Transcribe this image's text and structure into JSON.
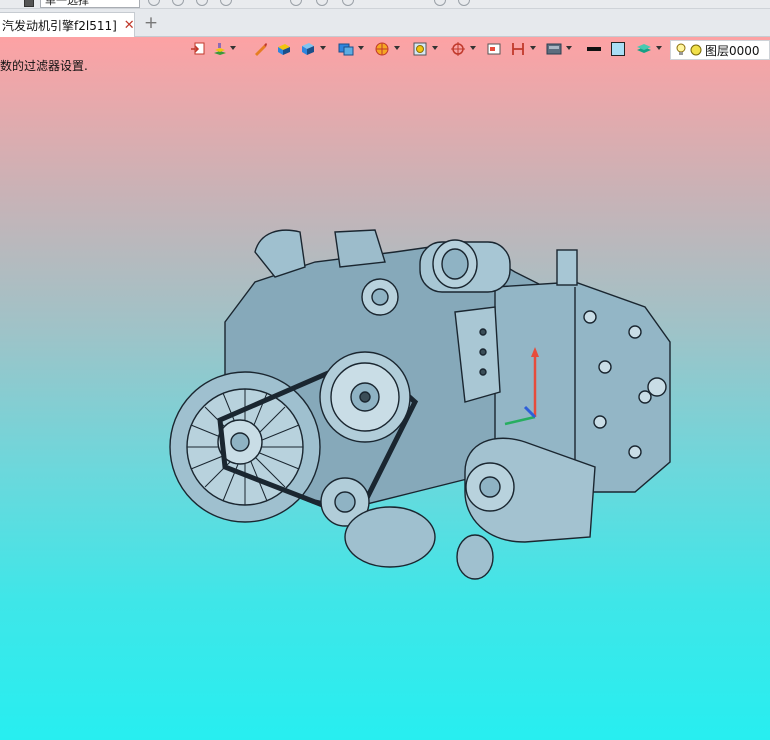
{
  "top": {
    "select_value": "单一选择"
  },
  "tab": {
    "title": "汽发动机引擎f2l511]",
    "close_glyph": "✕",
    "new_glyph": "+"
  },
  "status": {
    "message": "数的过滤器设置."
  },
  "layer": {
    "name": "图层0000"
  },
  "colors": {
    "accent": "#1e6fd9",
    "close": "#c0392b",
    "bg_top": "#fda2a4",
    "bg_bottom": "#27eef0",
    "model_fill": "#8fb3c4",
    "model_line": "#1a2630"
  },
  "toolbar": {
    "icons": [
      "view-orient-icon",
      "layer-paint-icon",
      "pencil-icon",
      "shaded-box-icon",
      "solid-cube-icon",
      "display-mode-icon",
      "sphere-icon",
      "frame-icon",
      "crosshair-icon",
      "window-icon",
      "clip-icon",
      "screen-icon",
      "black-swatch-icon",
      "color-swatch-icon",
      "layer-stack-icon",
      "bulb-icon",
      "layer-dot-icon"
    ]
  }
}
